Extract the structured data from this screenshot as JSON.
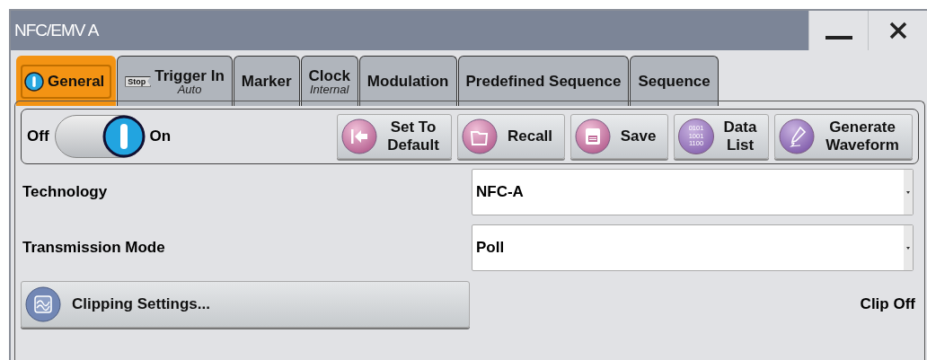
{
  "window": {
    "title": "NFC/EMV A",
    "controls": [
      {
        "kind": "minimize"
      },
      {
        "kind": "close"
      }
    ]
  },
  "tabs": [
    {
      "label": "General",
      "selected": true,
      "kind": "power"
    },
    {
      "label": "Trigger In",
      "sublabel": "Auto",
      "selected": false,
      "kind": "stop",
      "icon_text": "Stop"
    },
    {
      "label": "Marker",
      "selected": false
    },
    {
      "label": "Clock",
      "sublabel": "Internal",
      "selected": false
    },
    {
      "label": "Modulation",
      "selected": false
    },
    {
      "label": "Predefined Sequence",
      "selected": false
    },
    {
      "label": "Sequence",
      "selected": false
    }
  ],
  "state_toggle": {
    "off_label": "Off",
    "on_label": "On",
    "on": true
  },
  "toolbar": [
    {
      "kind": "default",
      "label": "Set To Default"
    },
    {
      "kind": "recall",
      "label": "Recall"
    },
    {
      "kind": "save",
      "label": "Save"
    },
    {
      "kind": "data",
      "label": "Data List",
      "icon_text": [
        "0101",
        "1001",
        "1100"
      ]
    },
    {
      "kind": "generate",
      "label": "Generate Waveform"
    }
  ],
  "settings": [
    {
      "label": "Technology",
      "value": "NFC-A"
    },
    {
      "label": "Transmission Mode",
      "value": "Poll"
    }
  ],
  "clipping": {
    "button": "Clipping Settings...",
    "status": "Clip Off"
  }
}
